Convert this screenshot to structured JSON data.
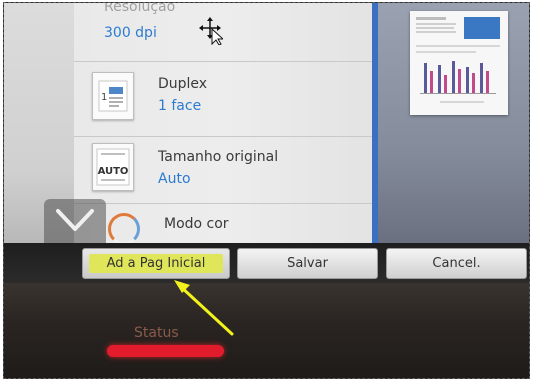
{
  "settings": {
    "resolucao": {
      "label": "Resolução",
      "value": "300 dpi"
    },
    "duplex": {
      "label": "Duplex",
      "value": "1 face",
      "thumb_text": "1"
    },
    "tamanho": {
      "label": "Tamanho original",
      "value": "Auto",
      "thumb_text": "AUTO"
    },
    "modo_cor": {
      "label": "Modo cor"
    }
  },
  "actions": {
    "home_label": "Ad a Pag Inicial",
    "save_label": "Salvar",
    "cancel_label": "Cancel."
  },
  "status": {
    "label": "Status"
  },
  "colors": {
    "accent_blue": "#2c7bd0",
    "highlight": "#dfe65a",
    "status_red": "#e21c2c",
    "arrow": "#f2f21c"
  },
  "icons": [
    "move-cursor-icon",
    "chevron-down-icon",
    "color-mode-icon",
    "annotation-arrow-icon"
  ]
}
